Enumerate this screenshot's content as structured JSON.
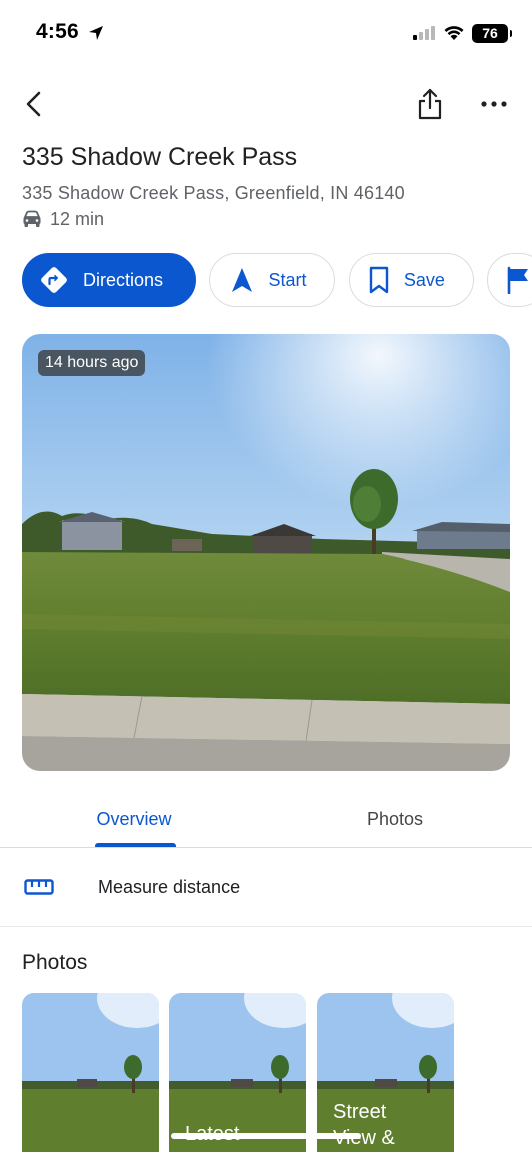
{
  "status_bar": {
    "time": "4:56",
    "battery": "76"
  },
  "place": {
    "title": "335 Shadow Creek Pass",
    "address": "335 Shadow Creek Pass, Greenfield, IN 46140",
    "drive_time": "12 min"
  },
  "actions": [
    {
      "label": "Directions",
      "icon": "directions-icon"
    },
    {
      "label": "Start",
      "icon": "navigation-arrow-icon"
    },
    {
      "label": "Save",
      "icon": "bookmark-icon"
    },
    {
      "label": "",
      "icon": "flag-icon"
    }
  ],
  "hero": {
    "badge": "14 hours ago"
  },
  "tabs": [
    {
      "label": "Overview",
      "active": true
    },
    {
      "label": "Photos",
      "active": false
    }
  ],
  "measure": {
    "label": "Measure distance"
  },
  "photos": {
    "heading": "Photos",
    "thumbs": [
      {
        "label": ""
      },
      {
        "label": "Latest"
      },
      {
        "label": "Street View &"
      }
    ]
  },
  "colors": {
    "accent": "#0b57d0",
    "text_primary": "#202124",
    "text_secondary": "#5f6368"
  }
}
